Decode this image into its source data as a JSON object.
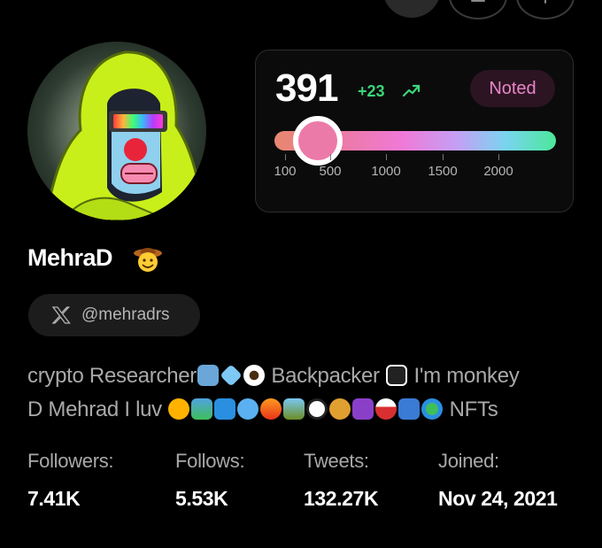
{
  "score_card": {
    "score": "391",
    "delta": "+23",
    "badge": "Noted",
    "slider_value": 391,
    "slider_ticks": [
      "100",
      "500",
      "1000",
      "1500",
      "2000"
    ]
  },
  "profile": {
    "name": "MehraD",
    "handle": "@mehradrs",
    "bio_line1_a": "crypto Researcher",
    "bio_line1_b": "Backpacker",
    "bio_line1_c": "I'm monkey",
    "bio_line2_a": "D Mehrad I luv",
    "bio_line2_b": "NFTs",
    "emoji_icons": [
      "magnifier-icon",
      "gem-icon",
      "eye-icon",
      "pirate-flag-icon",
      "sun-icon",
      "landscape-icon",
      "wave-icon",
      "dolphin-icon",
      "fire-icon",
      "camping-icon",
      "soccer-ball-icon",
      "money-bag-icon",
      "om-icon",
      "drum-icon",
      "luggage-icon",
      "globe-icon"
    ]
  },
  "stats": [
    {
      "label": "Followers:",
      "value": "7.41K"
    },
    {
      "label": "Follows:",
      "value": "5.53K"
    },
    {
      "label": "Tweets:",
      "value": "132.27K"
    },
    {
      "label": "Joined:",
      "value": "Nov 24, 2021"
    }
  ],
  "colors": {
    "accent_green": "#3bd67a",
    "badge_pink": "#e986c9",
    "slider_thumb": "#ec7aa8"
  }
}
